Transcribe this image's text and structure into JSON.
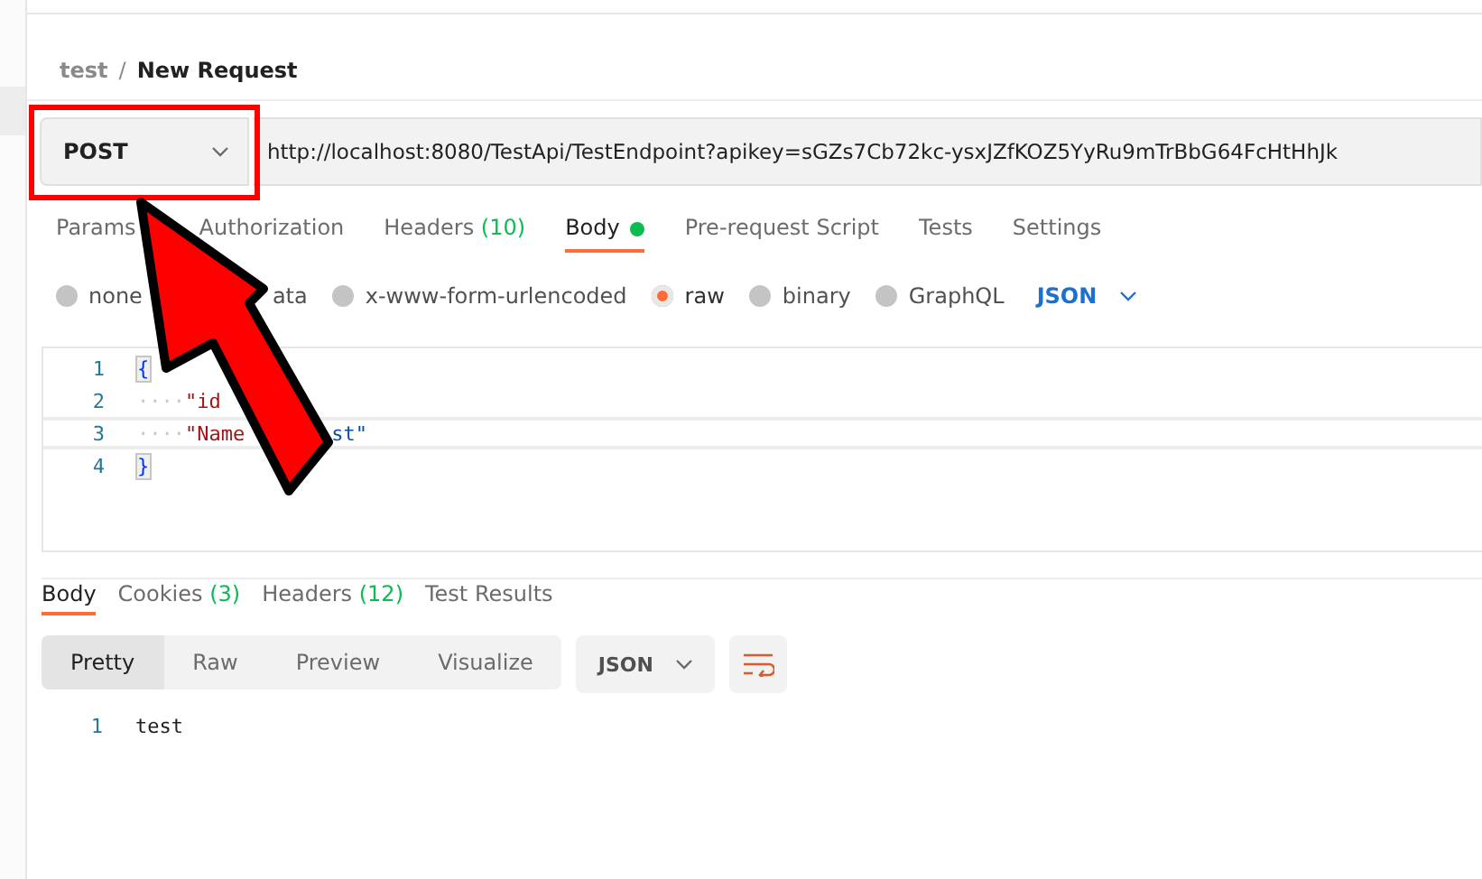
{
  "breadcrumb": {
    "collection": "test",
    "separator": "/",
    "request": "New Request"
  },
  "request": {
    "method": "POST",
    "url": "http://localhost:8080/TestApi/TestEndpoint?apikey=sGZs7Cb72kc-ysxJZfKOZ5YyRu9mTrBbG64FcHtHhJk"
  },
  "request_tabs": [
    {
      "label": "Params",
      "selected": false
    },
    {
      "label": "Authorization",
      "selected": false
    },
    {
      "label": "Headers",
      "count": "(10)",
      "selected": false
    },
    {
      "label": "Body",
      "dot": true,
      "selected": true
    },
    {
      "label": "Pre-request Script",
      "selected": false
    },
    {
      "label": "Tests",
      "selected": false
    },
    {
      "label": "Settings",
      "selected": false
    }
  ],
  "body_types": [
    {
      "label": "none",
      "selected": false
    },
    {
      "label": "ata"
    },
    {
      "label": "x-www-form-urlencoded",
      "selected": false
    },
    {
      "label": "raw",
      "selected": true
    },
    {
      "label": "binary",
      "selected": false
    },
    {
      "label": "GraphQL",
      "selected": false
    }
  ],
  "language": "JSON",
  "editor": {
    "lines": [
      {
        "number": "1",
        "parts": [
          {
            "text": "{",
            "kind": "brace"
          }
        ]
      },
      {
        "number": "2",
        "indent": "····",
        "parts": [
          {
            "text": "\"id",
            "kind": "key"
          }
        ]
      },
      {
        "number": "3",
        "indent": "····",
        "highlighted": true,
        "parts": [
          {
            "text": "\"Name",
            "kind": "key"
          },
          {
            "text": "st\"",
            "kind": "string"
          }
        ]
      },
      {
        "number": "4",
        "parts": [
          {
            "text": "}",
            "kind": "brace"
          }
        ]
      }
    ]
  },
  "response_tabs": [
    {
      "label": "Body",
      "selected": true
    },
    {
      "label": "Cookies",
      "count": "(3)",
      "selected": false
    },
    {
      "label": "Headers",
      "count": "(12)",
      "selected": false
    },
    {
      "label": "Test Results",
      "selected": false
    }
  ],
  "view_modes": [
    {
      "label": "Pretty",
      "selected": true
    },
    {
      "label": "Raw",
      "selected": false
    },
    {
      "label": "Preview",
      "selected": false
    },
    {
      "label": "Visualize",
      "selected": false
    }
  ],
  "response_format": "JSON",
  "response": {
    "lines": [
      {
        "number": "1",
        "text": "test"
      }
    ]
  }
}
